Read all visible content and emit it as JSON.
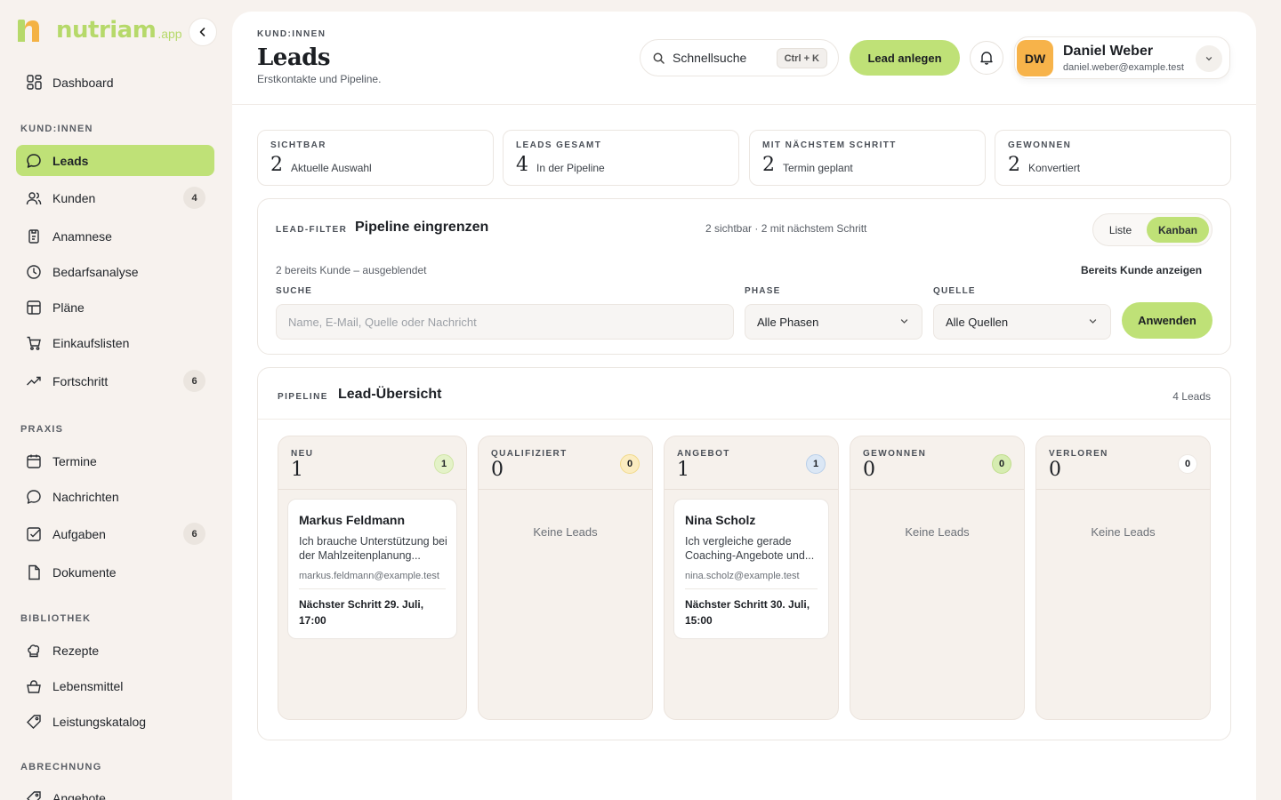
{
  "app": {
    "logo_text": "nutriam",
    "logo_suffix": ".app",
    "colors": {
      "accent": "#bfe177",
      "brand": "#b6d96a",
      "avatar": "#f7b34a"
    }
  },
  "sidebar": {
    "dashboard": "Dashboard",
    "sections": {
      "kunden": "KUND:INNEN",
      "praxis": "PRAXIS",
      "bibliothek": "BIBLIOTHEK",
      "abrechnung": "ABRECHNUNG"
    },
    "items": [
      {
        "label": "Leads",
        "icon": "chat-bubble-icon"
      },
      {
        "label": "Kunden",
        "icon": "users-icon",
        "badge": "4"
      },
      {
        "label": "Anamnese",
        "icon": "clipboard-icon"
      },
      {
        "label": "Bedarfsanalyse",
        "icon": "clock-icon"
      },
      {
        "label": "Pläne",
        "icon": "grid-icon"
      },
      {
        "label": "Einkaufslisten",
        "icon": "cart-icon"
      },
      {
        "label": "Fortschritt",
        "icon": "trend-icon",
        "badge": "6"
      },
      {
        "label": "Termine",
        "icon": "calendar-icon"
      },
      {
        "label": "Nachrichten",
        "icon": "message-icon"
      },
      {
        "label": "Aufgaben",
        "icon": "checkbox-icon",
        "badge": "6"
      },
      {
        "label": "Dokumente",
        "icon": "document-icon"
      },
      {
        "label": "Rezepte",
        "icon": "chef-hat-icon"
      },
      {
        "label": "Lebensmittel",
        "icon": "basket-icon"
      },
      {
        "label": "Leistungskatalog",
        "icon": "tag-icon"
      },
      {
        "label": "Angebote",
        "icon": "tag-icon"
      }
    ]
  },
  "header": {
    "eyebrow": "KUND:INNEN",
    "title": "Leads",
    "subtitle": "Erstkontakte und Pipeline.",
    "search_label": "Schnellsuche",
    "search_shortcut": "Ctrl + K",
    "new_lead": "Lead anlegen",
    "user": {
      "initials": "DW",
      "name": "Daniel Weber",
      "email": "daniel.weber@example.test"
    }
  },
  "stats": [
    {
      "label": "SICHTBAR",
      "value": "2",
      "desc": "Aktuelle Auswahl"
    },
    {
      "label": "LEADS GESAMT",
      "value": "4",
      "desc": "In der Pipeline"
    },
    {
      "label": "MIT NÄCHSTEM SCHRITT",
      "value": "2",
      "desc": "Termin geplant"
    },
    {
      "label": "GEWONNEN",
      "value": "2",
      "desc": "Konvertiert"
    }
  ],
  "filter": {
    "eyebrow": "LEAD-FILTER",
    "title": "Pipeline eingrenzen",
    "summary": "2 sichtbar · 2 mit nächstem Schritt",
    "view_list": "Liste",
    "view_kanban": "Kanban",
    "hidden_note": "2 bereits Kunde – ausgeblendet",
    "show_customers": "Bereits Kunde anzeigen",
    "search_label": "SUCHE",
    "search_placeholder": "Name, E-Mail, Quelle oder Nachricht",
    "phase_label": "PHASE",
    "phase_value": "Alle Phasen",
    "source_label": "QUELLE",
    "source_value": "Alle Quellen",
    "apply": "Anwenden"
  },
  "pipeline": {
    "eyebrow": "PIPELINE",
    "title": "Lead-Übersicht",
    "count": "4 Leads",
    "empty": "Keine Leads",
    "columns": [
      {
        "label": "NEU",
        "count": "1",
        "badge": "1",
        "badge_color": "#e4f2c8"
      },
      {
        "label": "QUALIFIZIERT",
        "count": "0",
        "badge": "0",
        "badge_color": "#fbecc0"
      },
      {
        "label": "ANGEBOT",
        "count": "1",
        "badge": "1",
        "badge_color": "#dbe7f5"
      },
      {
        "label": "GEWONNEN",
        "count": "0",
        "badge": "0",
        "badge_color": "#d6ecb1"
      },
      {
        "label": "VERLOREN",
        "count": "0",
        "badge": "0",
        "badge_color": "#ffffff"
      }
    ],
    "leads": [
      {
        "name": "Markus Feldmann",
        "message": "Ich brauche Unterstützung bei der Mahlzeitenplanung...",
        "email": "markus.feldmann@example.test",
        "next": "Nächster Schritt 29. Juli, 17:00"
      },
      {
        "name": "Nina Scholz",
        "message": "Ich vergleiche gerade Coaching-Angebote und...",
        "email": "nina.scholz@example.test",
        "next": "Nächster Schritt 30. Juli, 15:00"
      }
    ]
  }
}
